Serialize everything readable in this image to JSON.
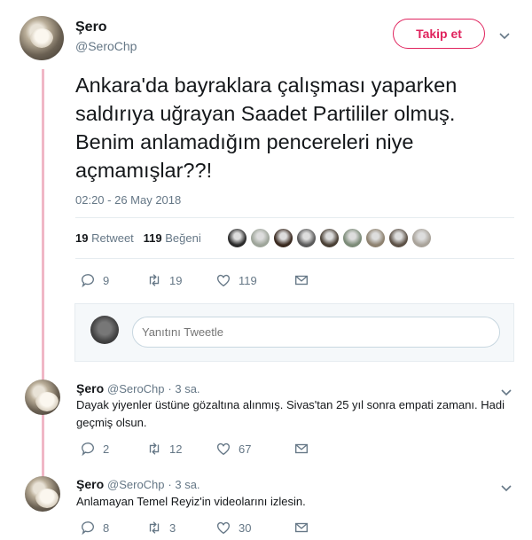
{
  "tweet": {
    "author_name": "Şero",
    "author_handle": "@SeroChp",
    "follow_label": "Takip et",
    "chevron": "⌄",
    "text": "Ankara'da bayraklara çalışması yaparken\nsaldırıya uğrayan Saadet Partililer olmuş.\nBenim anlamadığım pencereleri niye\naçmamışlar??!",
    "timestamp": "02:20 - 26 May 2018",
    "retweet_count": "19",
    "retweet_label": "Retweet",
    "like_count": "119",
    "like_label": "Beğeni",
    "liker_colors": [
      "#2b2b2b",
      "#9ea59a",
      "#3a2a20",
      "#5a5a5a",
      "#4a4035",
      "#7c8b78",
      "#8e8270",
      "#5d5247",
      "#a9a39a"
    ],
    "actions": {
      "reply": "9",
      "retweet": "19",
      "like": "119"
    }
  },
  "reply_box": {
    "placeholder": "Yanıtını Tweetle"
  },
  "replies": [
    {
      "name": "Şero",
      "handle": "@SeroChp",
      "time": "· 3 sa.",
      "text": "Dayak yiyenler üstüne gözaltına alınmış. Sivas'tan 25 yıl sonra empati zamanı. Hadi geçmiş olsun.",
      "reply": "2",
      "retweet": "12",
      "like": "67"
    },
    {
      "name": "Şero",
      "handle": "@SeroChp",
      "time": "· 3 sa.",
      "text": "Anlamayan Temel Reyiz'in videolarını izlesin.",
      "reply": "8",
      "retweet": "3",
      "like": "30"
    }
  ],
  "colors": {
    "accent": "#e0245e",
    "thread_line": "#f0b7c6",
    "muted": "#657786"
  },
  "icons": [
    "reply-icon",
    "retweet-icon",
    "heart-icon",
    "message-icon",
    "chevron-down-icon"
  ]
}
